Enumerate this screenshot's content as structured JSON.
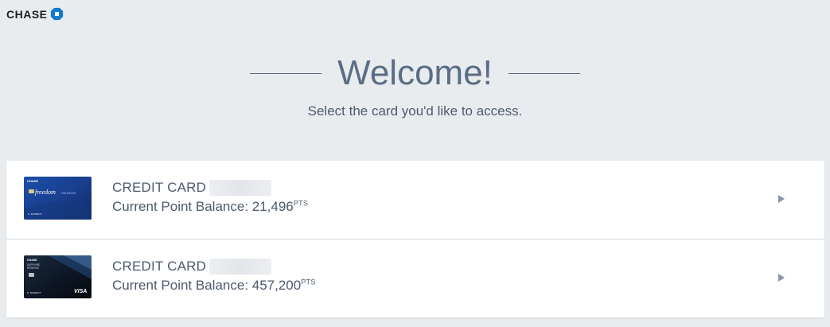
{
  "brand": {
    "name": "CHASE",
    "logo_icon": "chase-octagon-icon",
    "color": "#117aca"
  },
  "welcome": {
    "title": "Welcome!",
    "subtitle": "Select the card you'd like to access."
  },
  "cards": [
    {
      "title": "CREDIT CARD",
      "balance_label": "Current Point Balance: ",
      "balance_value": "21,496",
      "balance_unit": "PTS",
      "card_art": "chase-freedom-unlimited-card",
      "art_text": {
        "brand": "CHASE",
        "product": "freedom",
        "product_sub": "UNLIMITED",
        "holder": "D. BARRETT"
      }
    },
    {
      "title": "CREDIT CARD",
      "balance_label": "Current Point Balance: ",
      "balance_value": "457,200",
      "balance_unit": "PTS",
      "card_art": "chase-sapphire-reserve-card",
      "art_text": {
        "brand": "CHASE",
        "product": "SAPPHIRE",
        "product_sub": "RESERVE",
        "holder": "D. BARRETT",
        "network": "VISA"
      }
    }
  ]
}
